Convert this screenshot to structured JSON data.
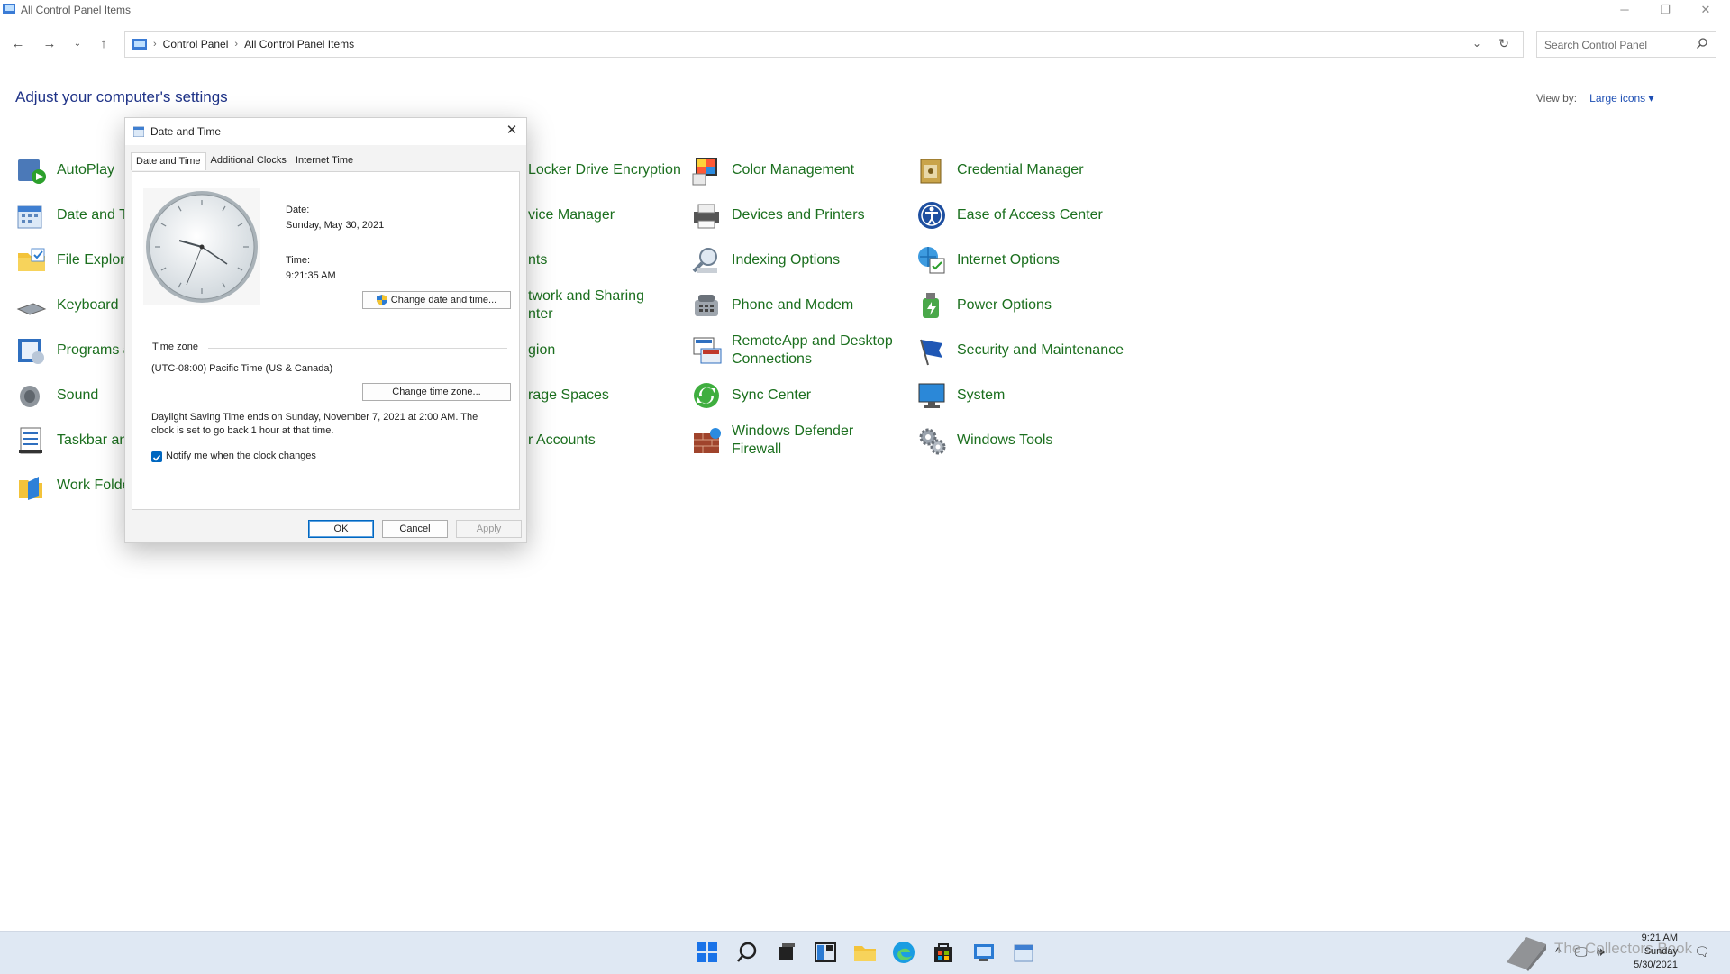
{
  "window": {
    "title": "All Control Panel Items"
  },
  "address": {
    "crumbs": [
      "Control Panel",
      "All Control Panel Items"
    ]
  },
  "search": {
    "placeholder": "Search Control Panel"
  },
  "heading": "Adjust your computer's settings",
  "view_by": {
    "label": "View by:",
    "value": "Large icons"
  },
  "items": [
    {
      "label": "AutoPlay",
      "icon": "autoplay-icon"
    },
    {
      "label": "Date and Ti",
      "icon": "calendar-icon"
    },
    {
      "label": "File Explore",
      "icon": "folder-icon"
    },
    {
      "label": "Keyboard",
      "icon": "keyboard-icon"
    },
    {
      "label": "Programs a",
      "icon": "programs-icon"
    },
    {
      "label": "Sound",
      "icon": "speaker-icon"
    },
    {
      "label": "Taskbar an",
      "icon": "taskbar-icon"
    },
    {
      "label": "Work Folde",
      "icon": "work-folders-icon"
    },
    {
      "label": "Locker Drive Encryption",
      "icon": "bitlocker-icon"
    },
    {
      "label": "vice Manager",
      "icon": "device-manager-icon"
    },
    {
      "label": "nts",
      "icon": "fonts-icon"
    },
    {
      "label": "twork and Sharing",
      "label2": "nter",
      "icon": "network-icon"
    },
    {
      "label": "gion",
      "icon": "region-icon"
    },
    {
      "label": "rage Spaces",
      "icon": "storage-icon"
    },
    {
      "label": "r Accounts",
      "icon": "user-accounts-icon"
    },
    {
      "label": "Color Management",
      "icon": "color-management-icon"
    },
    {
      "label": "Devices and Printers",
      "icon": "printer-icon"
    },
    {
      "label": "Indexing Options",
      "icon": "indexing-icon"
    },
    {
      "label": "Phone and Modem",
      "icon": "phone-icon"
    },
    {
      "label": "RemoteApp and Desktop",
      "label2": "Connections",
      "icon": "remoteapp-icon"
    },
    {
      "label": "Sync Center",
      "icon": "sync-icon"
    },
    {
      "label": "Windows Defender",
      "label2": "Firewall",
      "icon": "firewall-icon"
    },
    {
      "label": "Credential Manager",
      "icon": "credential-icon"
    },
    {
      "label": "Ease of Access Center",
      "icon": "ease-of-access-icon"
    },
    {
      "label": "Internet Options",
      "icon": "internet-options-icon"
    },
    {
      "label": "Power Options",
      "icon": "power-icon"
    },
    {
      "label": "Security and Maintenance",
      "icon": "flag-icon"
    },
    {
      "label": "System",
      "icon": "monitor-icon"
    },
    {
      "label": "Windows Tools",
      "icon": "gears-icon"
    }
  ],
  "dialog": {
    "title": "Date and Time",
    "tabs": [
      "Date and Time",
      "Additional Clocks",
      "Internet Time"
    ],
    "date_label": "Date:",
    "date_value": "Sunday, May 30, 2021",
    "time_label": "Time:",
    "time_value": "9:21:35 AM",
    "change_datetime": "Change date and time...",
    "timezone_heading": "Time zone",
    "timezone_value": "(UTC-08:00) Pacific Time (US & Canada)",
    "change_timezone": "Change time zone...",
    "dst_text_line1": "Daylight Saving Time ends on Sunday, November 7, 2021 at 2:00 AM. The",
    "dst_text_line2": "clock is set to go back 1 hour at that time.",
    "notify_label": "Notify me when the clock changes",
    "notify_checked": true,
    "ok": "OK",
    "cancel": "Cancel",
    "apply": "Apply"
  },
  "taskbar": {
    "clock_time": "9:21 AM",
    "clock_day": "Sunday",
    "clock_date": "5/30/2021",
    "watermark": "The Collectors Book"
  },
  "colors": {
    "link_green": "#1b6f1e",
    "heading_blue": "#1e3287",
    "accent": "#0067c0"
  }
}
